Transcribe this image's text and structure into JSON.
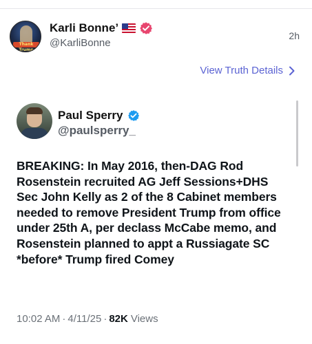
{
  "post": {
    "author_name": "Karli Bonne’",
    "author_handle": "@KarliBonne",
    "time": "2h",
    "avatar_text": "Thank Trump",
    "view_details_label": "View Truth Details"
  },
  "quoted": {
    "name": "Paul Sperry",
    "handle": "@paulsperry_",
    "text": "BREAKING: In May 2016, then-DAG Rod Rosenstein recruited AG Jeff Sessions+DHS Sec John Kelly as 2 of the 8 Cabinet members needed to remove President Trump from office under 25th A, per declass McCabe memo, and Rosenstein planned to appt a Russiagate SC *before* Trump fired Comey",
    "time": "10:02 AM",
    "date": "4/11/25",
    "views_count": "82K",
    "views_label": "Views"
  },
  "icons": {
    "flag": "us-flag-icon",
    "author_badge": "verified-badge-icon",
    "quoted_badge": "verified-badge-icon",
    "details": "chevron-right-icon"
  },
  "colors": {
    "link": "#5b63d3",
    "author_badge": "#e8466f",
    "quoted_badge": "#1d9bf0",
    "muted": "#555b63"
  }
}
